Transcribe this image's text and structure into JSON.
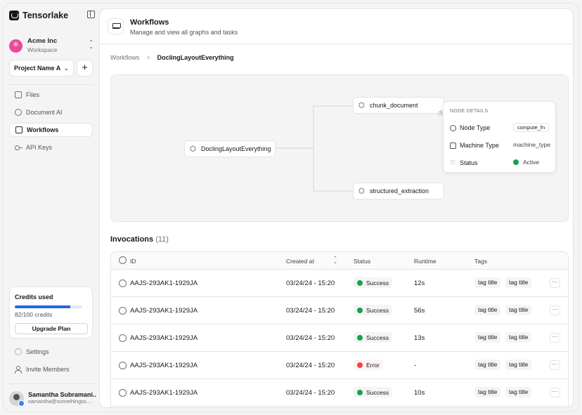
{
  "app": {
    "name": "Tensorlake"
  },
  "org": {
    "name": "Acme Inc",
    "subtitle": "Workspace"
  },
  "project": {
    "selected": "Project Name A",
    "add_label": "+"
  },
  "nav": [
    {
      "label": "Files",
      "icon": "file-icon"
    },
    {
      "label": "Document AI",
      "icon": "document-ai-icon"
    },
    {
      "label": "Workflows",
      "icon": "workflow-icon",
      "active": true
    },
    {
      "label": "API Keys",
      "icon": "key-icon"
    }
  ],
  "credits": {
    "title": "Credits used",
    "text": "82/100 credits",
    "used": 82,
    "total": 100,
    "button": "Upgrade Plan"
  },
  "footer_nav": [
    {
      "label": "Settings",
      "icon": "gear-icon"
    },
    {
      "label": "Invite Members",
      "icon": "user-plus-icon"
    }
  ],
  "user": {
    "name": "Samantha Subramani...",
    "email": "samantha@somethingss...."
  },
  "header": {
    "title": "Workflows",
    "subtitle": "Manage and view all graphs and tasks"
  },
  "breadcrumb": {
    "parent": "Workflows",
    "separator": ">",
    "current": "DoclingLayoutEverything"
  },
  "graph": {
    "root": "DoclingLayoutEverything",
    "children": [
      "chunk_document",
      "structured_extraction"
    ]
  },
  "node_details": {
    "title": "NODE DETAILS",
    "rows": [
      {
        "label": "Node Type",
        "value": "compute_fn"
      },
      {
        "label": "Machine Type",
        "value": "machine_type"
      },
      {
        "label": "Status",
        "value": "Active"
      }
    ]
  },
  "invocations": {
    "title": "Invocations",
    "count": "(11)",
    "columns": {
      "id": "ID",
      "created": "Created at",
      "status": "Status",
      "runtime": "Runtime",
      "tags": "Tags"
    },
    "rows": [
      {
        "id": "AAJS-293AK1-1929JA",
        "created": "03/24/24 - 15:20",
        "status": "Success",
        "runtime": "12s",
        "tags": [
          "tag title",
          "tag title"
        ]
      },
      {
        "id": "AAJS-293AK1-1929JA",
        "created": "03/24/24 - 15:20",
        "status": "Success",
        "runtime": "56s",
        "tags": [
          "tag title",
          "tag title"
        ]
      },
      {
        "id": "AAJS-293AK1-1929JA",
        "created": "03/24/24 - 15:20",
        "status": "Success",
        "runtime": "13s",
        "tags": [
          "tag title",
          "tag title"
        ]
      },
      {
        "id": "AAJS-293AK1-1929JA",
        "created": "03/24/24 - 15:20",
        "status": "Error",
        "runtime": "-",
        "tags": [
          "tag title",
          "tag title"
        ]
      },
      {
        "id": "AAJS-293AK1-1929JA",
        "created": "03/24/24 - 15:20",
        "status": "Success",
        "runtime": "10s",
        "tags": [
          "tag title",
          "tag title"
        ]
      }
    ],
    "more_label": "···"
  },
  "colors": {
    "accent": "#2563eb",
    "success": "#16a34a",
    "error": "#ef4444",
    "brand_avatar": "#ec4899"
  }
}
